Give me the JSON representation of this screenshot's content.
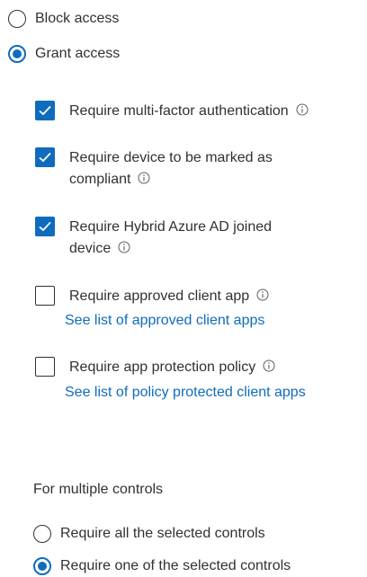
{
  "access": {
    "options": [
      {
        "label": "Block access",
        "selected": false
      },
      {
        "label": "Grant access",
        "selected": true
      }
    ]
  },
  "controls": [
    {
      "label_lines": [
        "Require multi-factor authentication"
      ],
      "checked": true,
      "info": true,
      "link": ""
    },
    {
      "label_lines": [
        "Require device to be marked as",
        "compliant"
      ],
      "checked": true,
      "info": true,
      "link": ""
    },
    {
      "label_lines": [
        "Require Hybrid Azure AD joined",
        "device"
      ],
      "checked": true,
      "info": true,
      "link": ""
    },
    {
      "label_lines": [
        "Require approved client app"
      ],
      "checked": false,
      "info": true,
      "link": "See list of approved client apps"
    },
    {
      "label_lines": [
        "Require app protection policy"
      ],
      "checked": false,
      "info": true,
      "link": "See list of policy protected client apps"
    }
  ],
  "multiple_controls": {
    "heading": "For multiple controls",
    "options": [
      {
        "label": "Require all the selected controls",
        "selected": false
      },
      {
        "label": "Require one of the selected controls",
        "selected": true
      }
    ]
  },
  "colors": {
    "accent": "#0f6cbd",
    "text": "#323130"
  }
}
